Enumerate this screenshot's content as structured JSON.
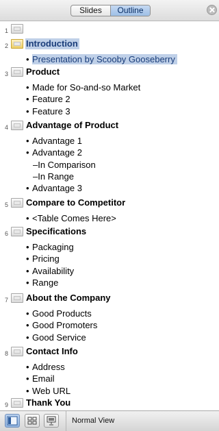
{
  "tabs": {
    "slides": "Slides",
    "outline": "Outline",
    "active": "outline"
  },
  "slides": [
    {
      "number": "1",
      "title": "",
      "items": []
    },
    {
      "number": "2",
      "title": "Introduction",
      "items": [
        {
          "text": "Presentation by Scooby Gooseberry",
          "type": "bullet"
        }
      ]
    },
    {
      "number": "3",
      "title": "Product",
      "items": [
        {
          "text": "Made for So-and-so Market",
          "type": "bullet"
        },
        {
          "text": "Feature 2",
          "type": "bullet"
        },
        {
          "text": "Feature 3",
          "type": "bullet"
        }
      ]
    },
    {
      "number": "4",
      "title": "Advantage of Product",
      "items": [
        {
          "text": "Advantage 1",
          "type": "bullet"
        },
        {
          "text": "Advantage 2",
          "type": "bullet"
        },
        {
          "text": "–In Comparison",
          "type": "sub"
        },
        {
          "text": "–In Range",
          "type": "sub"
        },
        {
          "text": "Advantage 3",
          "type": "bullet"
        }
      ]
    },
    {
      "number": "5",
      "title": "Compare to Competitor",
      "items": [
        {
          "text": "<Table Comes Here>",
          "type": "bullet"
        }
      ]
    },
    {
      "number": "6",
      "title": "Specifications",
      "items": [
        {
          "text": "Packaging",
          "type": "bullet"
        },
        {
          "text": "Pricing",
          "type": "bullet"
        },
        {
          "text": "Availability",
          "type": "bullet"
        },
        {
          "text": "Range",
          "type": "bullet"
        }
      ]
    },
    {
      "number": "7",
      "title": "About the Company",
      "items": [
        {
          "text": "Good Products",
          "type": "bullet"
        },
        {
          "text": "Good Promoters",
          "type": "bullet"
        },
        {
          "text": "Good Service",
          "type": "bullet"
        }
      ]
    },
    {
      "number": "8",
      "title": "Contact Info",
      "items": [
        {
          "text": "Address",
          "type": "bullet"
        },
        {
          "text": "Email",
          "type": "bullet"
        },
        {
          "text": "Web URL",
          "type": "bullet"
        }
      ]
    },
    {
      "number": "9",
      "title": "Thank You",
      "items": []
    }
  ],
  "bullet_glyph": "•",
  "bottom": {
    "view_label": "Normal View",
    "active_view": "normal"
  },
  "colors": {
    "selection": "#bfd0e8",
    "selection_text": "#1a3d7a",
    "tab_active": "#9ebfe6"
  }
}
